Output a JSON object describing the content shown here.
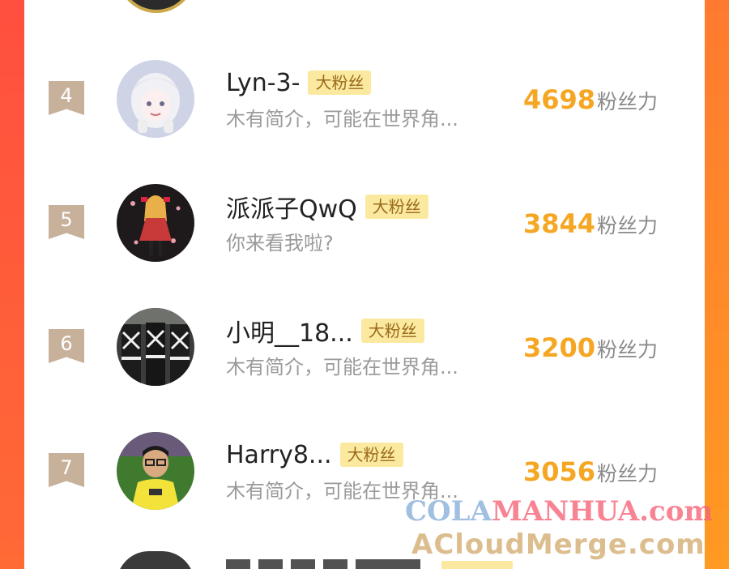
{
  "fans": [
    {
      "rank": "4",
      "name": "Lyn-3-",
      "badge": "大粉丝",
      "bio": "木有简介，可能在世界角...",
      "score": "4698",
      "score_unit": "粉丝力",
      "avatar_icon": "anime-girl-avatar-icon"
    },
    {
      "rank": "5",
      "name": "派派子QwQ",
      "badge": "大粉丝",
      "bio": "你来看我啦?",
      "score": "3844",
      "score_unit": "粉丝力",
      "avatar_icon": "anime-character-avatar-icon"
    },
    {
      "rank": "6",
      "name": "小明__18...",
      "badge": "大粉丝",
      "bio": "木有简介，可能在世界角...",
      "score": "3200",
      "score_unit": "粉丝力",
      "avatar_icon": "soldiers-avatar-icon"
    },
    {
      "rank": "7",
      "name": "Harry8...",
      "badge": "大粉丝",
      "bio": "木有简介，可能在世界角...",
      "score": "3056",
      "score_unit": "粉丝力",
      "avatar_icon": "person-photo-avatar-icon"
    }
  ],
  "watermark": {
    "line1_part1": "COLA",
    "line1_part2": "MANHUA.com",
    "line2": "ACloudMerge.com"
  },
  "colors": {
    "score": "#f5a623",
    "badge_bg": "#fbe9a0",
    "rank_bg": "#c8b19a",
    "edge_left": "#ff5a3c",
    "edge_right": "#ff9a25"
  }
}
